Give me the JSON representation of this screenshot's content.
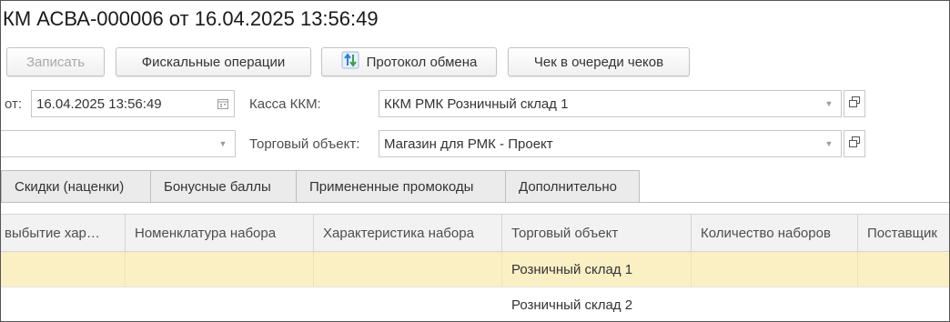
{
  "header": {
    "title": "КМ АСВА-000006 от 16.04.2025 13:56:49"
  },
  "toolbar": {
    "save_label": "Записать",
    "fiscal_label": "Фискальные операции",
    "protocol_label": "Протокол обмена",
    "queue_label": "Чек в очереди чеков"
  },
  "form": {
    "date_label": "от:",
    "date_value": "16.04.2025 13:56:49",
    "kassa_label": "Касса ККМ:",
    "kassa_value": "ККМ РМК Розничный склад 1",
    "unnamed_value": "",
    "trade_object_label": "Торговый объект:",
    "trade_object_value": "Магазин для РМК - Проект"
  },
  "tabs": [
    {
      "label": "Скидки (наценки)"
    },
    {
      "label": "Бонусные баллы"
    },
    {
      "label": "Примененные промокоды"
    },
    {
      "label": "Дополнительно"
    }
  ],
  "table": {
    "columns": [
      "выбытие хар…",
      "Номенклатура набора",
      "Характеристика набора",
      "Торговый объект",
      "Количество наборов",
      "Поставщик"
    ],
    "rows": [
      {
        "selected": true,
        "cells": [
          "",
          "",
          "",
          "Розничный склад 1",
          "",
          ""
        ]
      },
      {
        "selected": false,
        "cells": [
          "",
          "",
          "",
          "Розничный склад 2",
          "",
          ""
        ]
      }
    ]
  },
  "colors": {
    "selected_row": "#fbefc4",
    "header_bg": "#f2f2f2",
    "tab_bg": "#ebebeb"
  },
  "icons": [
    "protocol-icon",
    "calendar-icon",
    "dropdown-arrow-icon",
    "open-form-icon"
  ]
}
